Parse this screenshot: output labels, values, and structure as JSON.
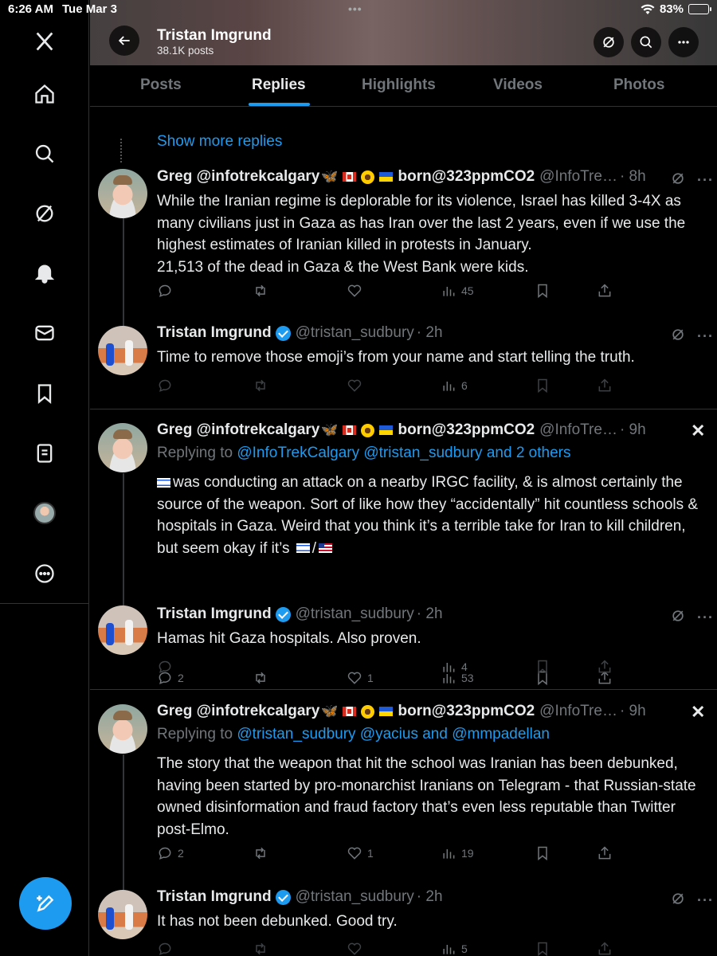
{
  "status_bar": {
    "time": "6:26 AM",
    "date": "Tue Mar 3",
    "battery": "83%",
    "battery_level": 0.83
  },
  "header": {
    "name": "Tristan Imgrund",
    "posts": "38.1K posts"
  },
  "tabs": [
    "Posts",
    "Replies",
    "Highlights",
    "Videos",
    "Photos"
  ],
  "active_tab": "Replies",
  "show_more": "Show more replies",
  "tweets": [
    {
      "name": "Greg @infotrekcalgary",
      "extra": "born@323ppmCO2",
      "handle": "@InfoTre…",
      "time": "· 8h",
      "body": "While the Iranian regime is deplorable for its violence, Israel has killed 3-4X as many civilians just in Gaza as has Iran over  the last 2 years, even if we use the highest estimates of Iranian killed in protests in January.\n21,513 of the dead in Gaza & the West Bank were kids.",
      "replies": "",
      "reposts": "",
      "likes": "",
      "views": "45"
    },
    {
      "name": "Tristan Imgrund",
      "handle": "@tristan_sudbury",
      "time": "· 2h",
      "body": "Time to remove those emoji’s from your name and start telling the truth.",
      "replies": "",
      "reposts": "",
      "likes": "",
      "views": "6"
    },
    {
      "name": "Greg @infotrekcalgary",
      "extra": "born@323ppmCO2",
      "handle": "@InfoTre…",
      "time": "· 9h",
      "replying_prefix": "Replying to",
      "replying_to": "@InfoTrekCalgary @tristan_sudbury and 2 others",
      "body_a": "was conducting an attack on a nearby IRGC facility, & is almost certainly the source of the weapon. Sort of like how they “accidentally” hit countless schools & hospitals in Gaza. Weird that you think it’s a terrible take for Iran to kill children, but seem okay if it’s ",
      "body_sep": "/",
      "replies": "2",
      "reposts": "",
      "likes": "1",
      "views": "53"
    },
    {
      "name": "Tristan Imgrund",
      "handle": "@tristan_sudbury",
      "time": "· 2h",
      "body": "Hamas hit Gaza hospitals. Also proven.",
      "replies": "",
      "reposts": "",
      "likes": "",
      "views": "4"
    },
    {
      "name": "Greg @infotrekcalgary",
      "extra": "born@323ppmCO2",
      "handle": "@InfoTre…",
      "time": "· 9h",
      "replying_prefix": "Replying to",
      "replying_to": "@tristan_sudbury @yacius and @mmpadellan",
      "body": "The story that the weapon that hit the school was Iranian has been debunked, having been started by pro-monarchist Iranians on Telegram - that Russian-state owned disinformation and fraud factory that’s even less reputable than Twitter post-Elmo.",
      "replies": "2",
      "reposts": "",
      "likes": "1",
      "views": "19"
    },
    {
      "name": "Tristan Imgrund",
      "handle": "@tristan_sudbury",
      "time": "· 2h",
      "body": "It has not been debunked. Good try.",
      "replies": "",
      "reposts": "",
      "likes": "",
      "views": "5"
    }
  ],
  "colors": {
    "accent": "#1d9bf0",
    "background": "#000000",
    "muted": "#71767b",
    "border": "#2f3336"
  }
}
